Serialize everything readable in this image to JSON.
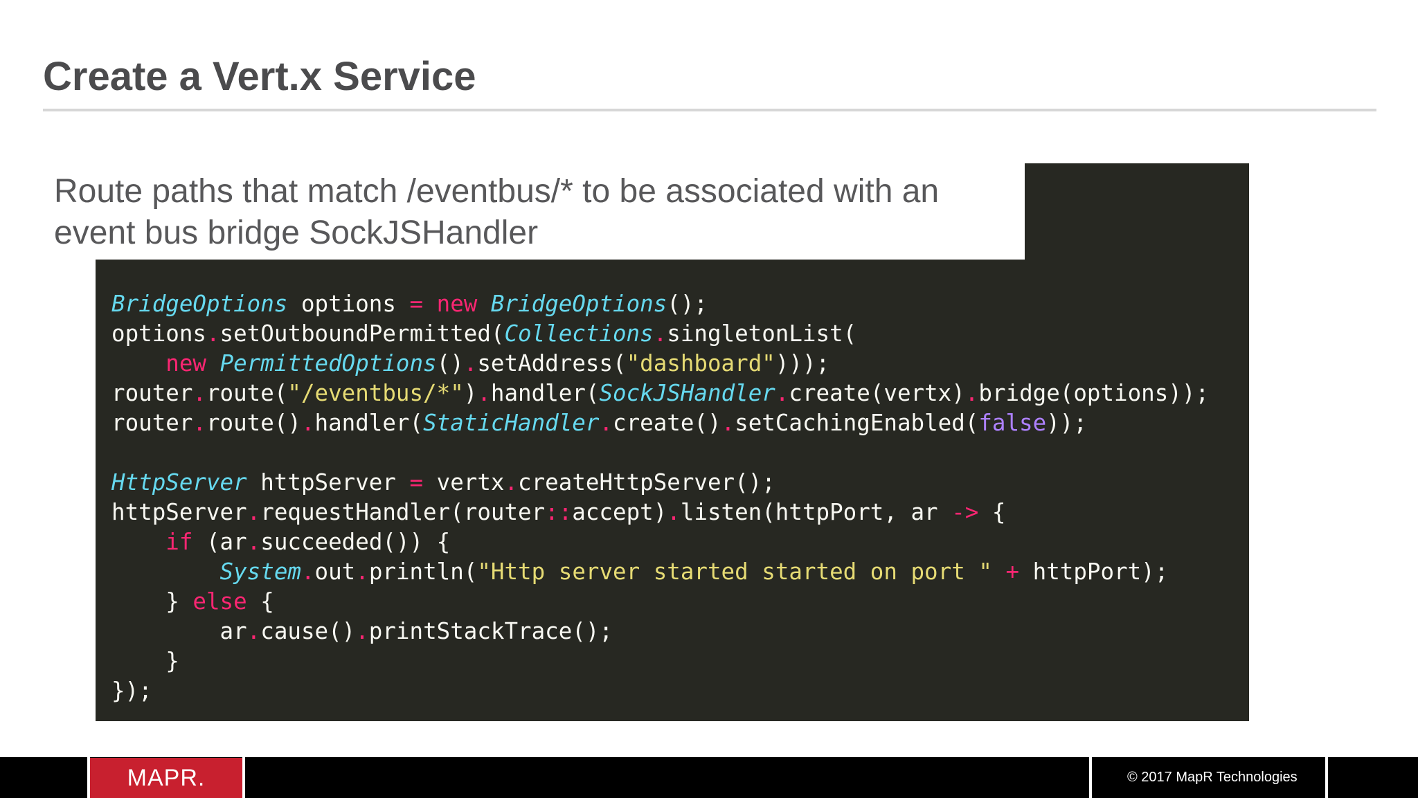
{
  "slide": {
    "title": "Create a Vert.x Service",
    "subtitle": "Route paths that match /eventbus/* to be associated with an event bus bridge SockJSHandler"
  },
  "colors": {
    "title": "#4b4b4d",
    "rule": "#d6d6d6",
    "code_background": "#272822",
    "code_class": "#66d9ef",
    "code_keyword": "#f92672",
    "code_string": "#e6db74",
    "code_boolean": "#ae81ff",
    "code_plain": "#f8f8f2",
    "brand_red": "#c8202f",
    "footer": "#000000"
  },
  "code": {
    "language": "java",
    "lines": [
      [
        [
          "cls",
          "BridgeOptions"
        ],
        [
          "plain",
          " options "
        ],
        [
          "op",
          "="
        ],
        [
          "plain",
          " "
        ],
        [
          "kw",
          "new"
        ],
        [
          "plain",
          " "
        ],
        [
          "cls",
          "BridgeOptions"
        ],
        [
          "plain",
          "();"
        ]
      ],
      [
        [
          "plain",
          "options"
        ],
        [
          "op",
          "."
        ],
        [
          "plain",
          "setOutboundPermitted("
        ],
        [
          "cls",
          "Collections"
        ],
        [
          "op",
          "."
        ],
        [
          "plain",
          "singletonList("
        ]
      ],
      [
        [
          "plain",
          "    "
        ],
        [
          "kw",
          "new"
        ],
        [
          "plain",
          " "
        ],
        [
          "cls",
          "PermittedOptions"
        ],
        [
          "plain",
          "()"
        ],
        [
          "op",
          "."
        ],
        [
          "plain",
          "setAddress("
        ],
        [
          "str",
          "\"dashboard\""
        ],
        [
          "plain",
          ")));"
        ]
      ],
      [
        [
          "plain",
          "router"
        ],
        [
          "op",
          "."
        ],
        [
          "plain",
          "route("
        ],
        [
          "str",
          "\"/eventbus/*\""
        ],
        [
          "plain",
          ")"
        ],
        [
          "op",
          "."
        ],
        [
          "plain",
          "handler("
        ],
        [
          "cls",
          "SockJSHandler"
        ],
        [
          "op",
          "."
        ],
        [
          "plain",
          "create(vertx)"
        ],
        [
          "op",
          "."
        ],
        [
          "plain",
          "bridge(options));"
        ]
      ],
      [
        [
          "plain",
          "router"
        ],
        [
          "op",
          "."
        ],
        [
          "plain",
          "route()"
        ],
        [
          "op",
          "."
        ],
        [
          "plain",
          "handler("
        ],
        [
          "cls",
          "StaticHandler"
        ],
        [
          "op",
          "."
        ],
        [
          "plain",
          "create()"
        ],
        [
          "op",
          "."
        ],
        [
          "plain",
          "setCachingEnabled("
        ],
        [
          "bool",
          "false"
        ],
        [
          "plain",
          "));"
        ]
      ],
      [],
      [
        [
          "cls",
          "HttpServer"
        ],
        [
          "plain",
          " httpServer "
        ],
        [
          "op",
          "="
        ],
        [
          "plain",
          " vertx"
        ],
        [
          "op",
          "."
        ],
        [
          "plain",
          "createHttpServer();"
        ]
      ],
      [
        [
          "plain",
          "httpServer"
        ],
        [
          "op",
          "."
        ],
        [
          "plain",
          "requestHandler(router"
        ],
        [
          "op",
          "::"
        ],
        [
          "plain",
          "accept)"
        ],
        [
          "op",
          "."
        ],
        [
          "plain",
          "listen(httpPort, ar "
        ],
        [
          "op",
          "->"
        ],
        [
          "plain",
          " {"
        ]
      ],
      [
        [
          "plain",
          "    "
        ],
        [
          "kw",
          "if"
        ],
        [
          "plain",
          " (ar"
        ],
        [
          "op",
          "."
        ],
        [
          "plain",
          "succeeded()) {"
        ]
      ],
      [
        [
          "plain",
          "        "
        ],
        [
          "cls",
          "System"
        ],
        [
          "op",
          "."
        ],
        [
          "plain",
          "out"
        ],
        [
          "op",
          "."
        ],
        [
          "plain",
          "println("
        ],
        [
          "str",
          "\"Http server started started on port \""
        ],
        [
          "plain",
          " "
        ],
        [
          "op",
          "+"
        ],
        [
          "plain",
          " httpPort);"
        ]
      ],
      [
        [
          "plain",
          "    } "
        ],
        [
          "kw",
          "else"
        ],
        [
          "plain",
          " {"
        ]
      ],
      [
        [
          "plain",
          "        ar"
        ],
        [
          "op",
          "."
        ],
        [
          "plain",
          "cause()"
        ],
        [
          "op",
          "."
        ],
        [
          "plain",
          "printStackTrace();"
        ]
      ],
      [
        [
          "plain",
          "    }"
        ]
      ],
      [
        [
          "plain",
          "});"
        ]
      ]
    ]
  },
  "footer": {
    "logo_text": "MAPR.",
    "copyright": "© 2017 MapR Technologies"
  }
}
